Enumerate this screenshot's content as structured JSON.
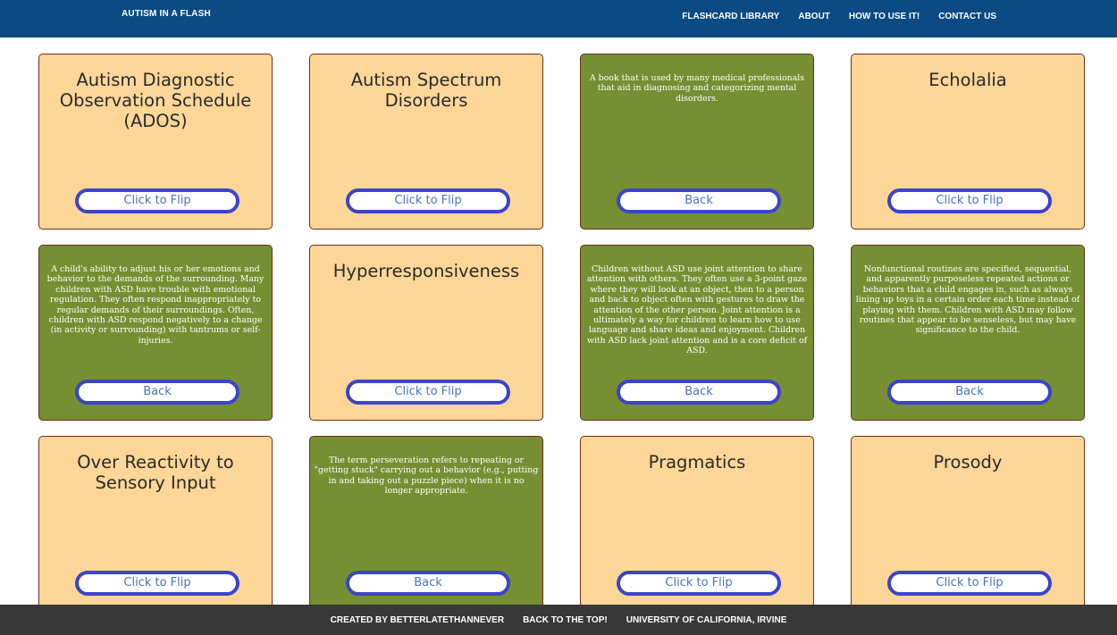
{
  "header": {
    "brand": "AUTISM IN A FLASH",
    "nav": [
      {
        "label": "FLASHCARD LIBRARY"
      },
      {
        "label": "ABOUT"
      },
      {
        "label": "HOW TO USE IT!"
      },
      {
        "label": "CONTACT US"
      }
    ]
  },
  "cards": [
    {
      "side": "front",
      "text": "Autism Diagnostic Observation Schedule (ADOS)",
      "button": "Click to Flip"
    },
    {
      "side": "front",
      "text": "Autism Spectrum Disorders",
      "button": "Click to Flip"
    },
    {
      "side": "back",
      "text": "A book that is used by many medical professionals that aid in diagnosing and categorizing mental disorders.",
      "button": "Back"
    },
    {
      "side": "front",
      "text": "Echolalia",
      "button": "Click to Flip"
    },
    {
      "side": "back",
      "text": "A child's ability to adjust his or her emotions and behavior to the demands of the surrounding. Many children with ASD have trouble with emotional regulation. They often respond inappropriately to regular demands of their surroundings. Often, children with ASD respond negatively to a change (in activity or surrounding) with tantrums or self-injuries.",
      "button": "Back"
    },
    {
      "side": "front",
      "text": "Hyperresponsiveness",
      "button": "Click to Flip"
    },
    {
      "side": "back",
      "text": "Children without ASD use joint attention to share attention with others. They often use a 3-point gaze where they will look at an object, then to a person and back to object often with gestures to draw the attention of the other person. Joint attention is a ultimately a way for children to learn how to use language and share ideas and enjoyment. Children with ASD lack joint attention and is a core deficit of ASD.",
      "button": "Back"
    },
    {
      "side": "back",
      "text": "Nonfunctional routines are specified, sequential, and apparently purposeless repeated actions or behaviors that a child engages in, such as always lining up toys in a certain order each time instead of playing with them. Children with ASD may follow routines that appear to be senseless, but may have significance to the child.",
      "button": "Back"
    },
    {
      "side": "front",
      "text": "Over Reactivity to Sensory Input",
      "button": "Click to Flip"
    },
    {
      "side": "back",
      "text": "The term perseveration refers to repeating or \"getting stuck\" carrying out a behavior (e.g., putting in and taking out a puzzle piece) when it is no longer appropriate.",
      "button": "Back"
    },
    {
      "side": "front",
      "text": "Pragmatics",
      "button": "Click to Flip"
    },
    {
      "side": "front",
      "text": "Prosody",
      "button": "Click to Flip"
    }
  ],
  "footer": {
    "links": [
      {
        "label": "CREATED BY BETTERLATETHANNEVER"
      },
      {
        "label": "BACK TO THE TOP!"
      },
      {
        "label": "UNIVERSITY OF CALIFORNIA, IRVINE"
      }
    ]
  },
  "colors": {
    "header_bg": "#0b4a82",
    "card_front": "#fed798",
    "card_back": "#758f32",
    "button_border": "#3b44c8",
    "button_text": "#4a73b5",
    "footer_bg": "#383838"
  }
}
